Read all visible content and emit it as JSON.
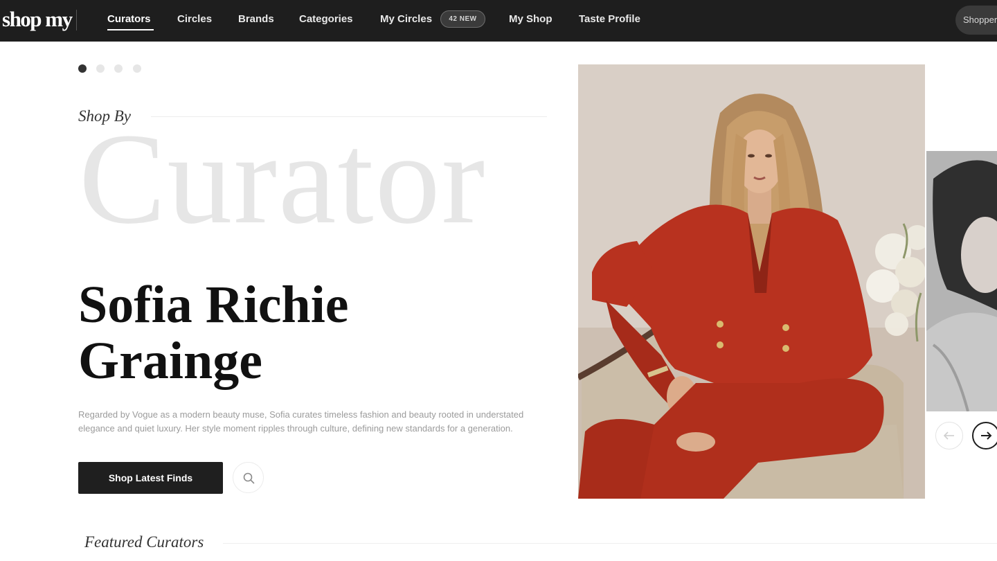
{
  "nav": {
    "logo": "shop my",
    "items": [
      {
        "label": "Curators"
      },
      {
        "label": "Circles"
      },
      {
        "label": "Brands"
      },
      {
        "label": "Categories"
      },
      {
        "label": "My Circles"
      },
      {
        "label": "My Shop"
      },
      {
        "label": "Taste Profile"
      }
    ],
    "active_item": "Curators",
    "my_circles_badge": "42 NEW",
    "shopper_label": "Shopper"
  },
  "carousel": {
    "slide_count": 4,
    "active_index": 0
  },
  "hero": {
    "eyebrow": "Shop By",
    "watermark": "Curator",
    "curator_name": "Sofia Richie Grainge",
    "bio": "Regarded by Vogue as a modern beauty muse, Sofia curates timeless fashion and beauty rooted in understated elegance and quiet luxury. Her style moment ripples through culture, defining new standards for a generation.",
    "cta_label": "Shop Latest Finds",
    "search_icon": "search-icon"
  },
  "photo_controls": {
    "prev_icon": "arrow-left-icon",
    "next_icon": "arrow-right-icon"
  },
  "featured": {
    "heading": "Featured Curators"
  },
  "colors": {
    "nav_bg": "#1e1e1e",
    "cta_bg": "#1f1f1f",
    "watermark_text": "#e6e6e6",
    "suit_red": "#b8321f"
  }
}
